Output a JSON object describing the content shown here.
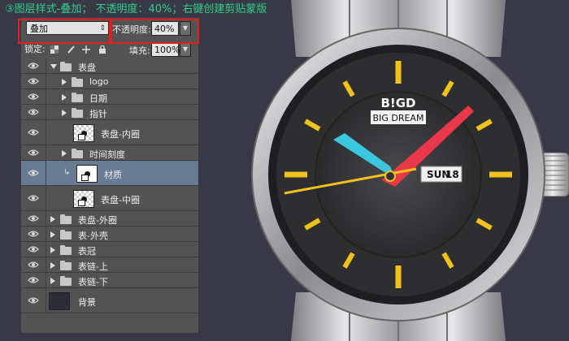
{
  "caption": "③图层样式-叠加； 不透明度：40%；右键创建剪贴蒙版",
  "controls": {
    "blend_mode": "叠加",
    "opacity_label": "不透明度:",
    "opacity_value": "40%",
    "lock_label": "锁定:",
    "fill_label": "填充:",
    "fill_value": "100%"
  },
  "layers": [
    {
      "name": "表盘",
      "type": "group",
      "expanded": true,
      "indent": 0
    },
    {
      "name": "logo",
      "type": "group",
      "expanded": false,
      "indent": 1
    },
    {
      "name": "日期",
      "type": "group",
      "expanded": false,
      "indent": 1
    },
    {
      "name": "指针",
      "type": "group",
      "expanded": false,
      "indent": 1
    },
    {
      "name": "表盘-内圈",
      "type": "layer",
      "indent": 1
    },
    {
      "name": "时间刻度",
      "type": "group",
      "expanded": false,
      "indent": 1
    },
    {
      "name": "材质",
      "type": "layer",
      "indent": 1,
      "selected": true,
      "clipped": true
    },
    {
      "name": "表盘-中圈",
      "type": "layer",
      "indent": 1
    },
    {
      "name": "表盘-外圈",
      "type": "group",
      "expanded": false,
      "indent": 0
    },
    {
      "name": "表-外壳",
      "type": "group",
      "expanded": false,
      "indent": 0
    },
    {
      "name": "表冠",
      "type": "group",
      "expanded": false,
      "indent": 0
    },
    {
      "name": "表链-上",
      "type": "group",
      "expanded": false,
      "indent": 0
    },
    {
      "name": "表链-下",
      "type": "group",
      "expanded": false,
      "indent": 0
    },
    {
      "name": "背景",
      "type": "background",
      "indent": 0
    }
  ],
  "watch": {
    "brand": "B!GD",
    "brand_sub": "BIG DREAM",
    "day": "SUN",
    "date": "18"
  },
  "colors": {
    "caption": "#2fd08a",
    "marker": "#f1c21b",
    "hour_hand": "#3bc7e0",
    "minute_hand": "#e8384a",
    "second_hand": "#f1c21b",
    "highlight_box": "#e02020"
  }
}
